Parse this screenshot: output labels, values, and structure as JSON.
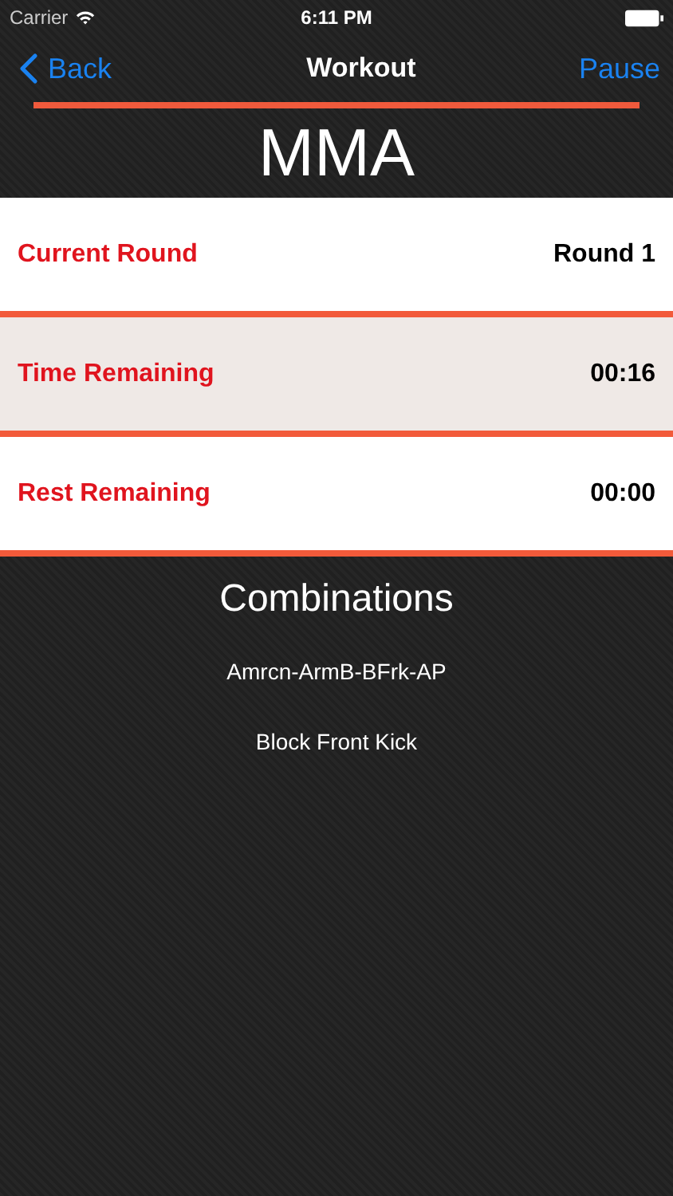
{
  "status_bar": {
    "carrier": "Carrier",
    "time": "6:11 PM"
  },
  "nav": {
    "back": "Back",
    "title": "Workout",
    "action": "Pause"
  },
  "workout_name": "MMA",
  "rows": [
    {
      "label": "Current Round",
      "value": "Round 1",
      "selected": false
    },
    {
      "label": "Time Remaining",
      "value": "00:16",
      "selected": true
    },
    {
      "label": "Rest Remaining",
      "value": "00:00",
      "selected": false
    }
  ],
  "combinations": {
    "title": "Combinations",
    "items": [
      "Amrcn-ArmB-BFrk-AP",
      "Block Front Kick"
    ]
  }
}
